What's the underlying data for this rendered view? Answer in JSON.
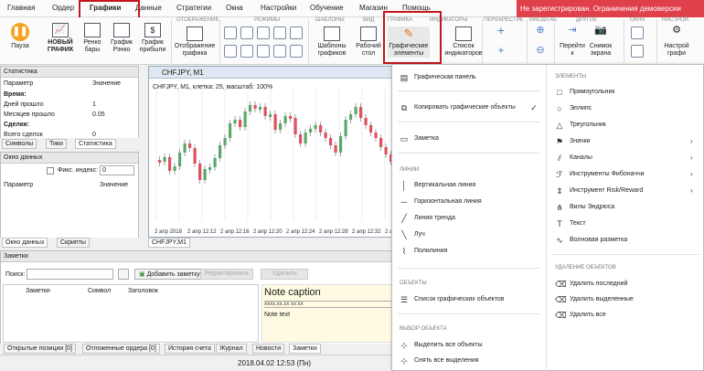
{
  "menu": [
    "Главная",
    "Ордер",
    "Графики",
    "Данные",
    "Стратегии",
    "Окна",
    "Настройки",
    "Обучение",
    "Магазин",
    "Помощь"
  ],
  "warning": "Не зарегистрирован. Ограничения демоверсии",
  "ribbon": {
    "groups": [
      "ОТОБРАЖЕНИЕ",
      "РЕЖИМЫ",
      "ШАБЛОНЫ",
      "ВИД",
      "ГРАФИКА",
      "ИНДИКАТОРЫ",
      "ПЕРЕКРЕСТИЕ",
      "МАСШТАБ",
      "ДРУГОЕ",
      "ОКНА",
      "НАСТРОЙ"
    ],
    "pause": "Пауза",
    "new_chart": "НОВЫЙ ГРАФИК",
    "renko": "Ренко бары",
    "chart_renko": "График Рэнко",
    "chart_profit": "График прибыли",
    "display_chart": "Отображение графика",
    "templates": "Шаблоны графиков",
    "desktop": "Рабочий стол",
    "graphic_elements": "Графические элементы",
    "indicator_list": "Список индикаторов",
    "goto": "Перейти к",
    "snapshot": "Снимок экрана",
    "settings": "Настрой графи"
  },
  "stats": {
    "title": "Статистика",
    "col_param": "Параметр",
    "col_value": "Значение",
    "rows": [
      {
        "p": "Время:",
        "v": "",
        "b": true
      },
      {
        "p": "Дней прошло",
        "v": "1",
        "b": false
      },
      {
        "p": "Месяцев прошло",
        "v": "0.05",
        "b": false
      },
      {
        "p": "Сделки:",
        "v": "",
        "b": true
      },
      {
        "p": "Всего сделок",
        "v": "0",
        "b": false
      }
    ],
    "tabs": [
      "Символы",
      "Тики",
      "Статистика"
    ]
  },
  "datawin": {
    "title": "Окно данных",
    "fix_label": "Фикс. индекс:",
    "fix_value": "0",
    "col_param": "Параметр",
    "col_value": "Значение",
    "tabs": [
      "Окно данных",
      "Скрипты"
    ]
  },
  "chart": {
    "window_title": "CHFJPY, M1",
    "info": "CHFJPY, M1, клетка: 25, масштаб: 100%",
    "x_labels": [
      "2 апр 2018",
      "2 апр 12:12",
      "2 апр 12:16",
      "2 апр 12:20",
      "2 апр 12:24",
      "2 апр 12:28",
      "2 апр 12:32",
      "2 апр 12:36"
    ],
    "tab": "CHFJPY,M1"
  },
  "notes": {
    "title": "Заметки",
    "search_label": "Поиск:",
    "add_btn": "Добавить заметку",
    "edit_btn": "Редактировать",
    "delete_btn": "Удалить",
    "cols": [
      "Заметки",
      "Символ",
      "Заголовок"
    ],
    "caption": "Note caption",
    "date": "xxxx.xx.xx xx:xx",
    "text": "Note text"
  },
  "bottom_tabs": [
    "Открытые позиции [0]",
    "Отложенные ордера [0]",
    "История счета",
    "Журнал",
    "Новости",
    "Заметки"
  ],
  "status": "2018.04.02 12:53 (Пн)",
  "dropdown": {
    "left": {
      "panel": "Графическая панель",
      "copy": "Копировать графические объекты",
      "note": "Заметка",
      "lines_head": "ЛИНИИ",
      "lines": [
        "Вертикальная линия",
        "Горизонтальная линия",
        "Линия тренда",
        "Луч",
        "Полилиния"
      ],
      "objects_head": "ОБЪЕКТЫ",
      "obj_list": "Список графических объектов",
      "select_head": "ВЫБОР ОБЪЕКТА",
      "select_all": "Выделить все объекты",
      "deselect_all": "Снять все выделения"
    },
    "right": {
      "elements_head": "ЭЛЕМЕНТЫ",
      "elements": [
        "Прямоугольник",
        "Эллипс",
        "Треугольник",
        "Значки",
        "Каналы",
        "Инструменты Фибоначчи",
        "Инструмент Risk/Reward",
        "Вилы Эндрюса",
        "Текст",
        "Волновая разметка"
      ],
      "delete_head": "УДАЛЕНИЕ ОБЪЕКТОВ",
      "delete": [
        "Удалить последний",
        "Удалить выделенные",
        "Удалить все"
      ]
    }
  }
}
